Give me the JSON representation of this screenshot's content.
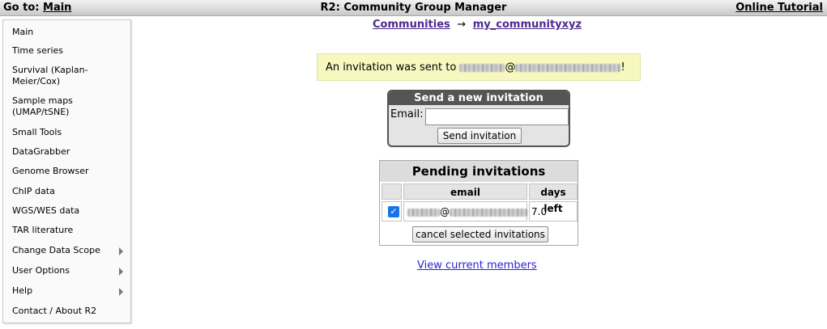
{
  "topbar": {
    "goto_prefix": "Go to:",
    "goto_link": "Main",
    "title": "R2: Community Group Manager",
    "tutorial": "Online Tutorial"
  },
  "sidebar": {
    "items": [
      {
        "label": "Main",
        "submenu": false
      },
      {
        "label": "Time series",
        "submenu": false
      },
      {
        "label": "Survival (Kaplan-Meier/Cox)",
        "submenu": false
      },
      {
        "label": "Sample maps (UMAP/tSNE)",
        "submenu": false
      },
      {
        "label": "Small Tools",
        "submenu": false
      },
      {
        "label": "DataGrabber",
        "submenu": false
      },
      {
        "label": "Genome Browser",
        "submenu": false
      },
      {
        "label": "ChIP data",
        "submenu": false
      },
      {
        "label": "WGS/WES data",
        "submenu": false
      },
      {
        "label": "TAR literature",
        "submenu": false
      },
      {
        "label": "Change Data Scope",
        "submenu": true
      },
      {
        "label": "User Options",
        "submenu": true
      },
      {
        "label": "Help",
        "submenu": true
      },
      {
        "label": "Contact / About R2",
        "submenu": false
      }
    ]
  },
  "breadcrumb": {
    "root": "Communities",
    "separator": "→",
    "current": "my_communityxyz"
  },
  "notice": {
    "prefix": "An invitation was sent to ",
    "at": "@",
    "suffix": "!"
  },
  "invite": {
    "title": "Send a new invitation",
    "email_label": "Email:",
    "email_value": "",
    "button": "Send invitation"
  },
  "pending": {
    "title": "Pending invitations",
    "columns": [
      "email",
      "days left"
    ],
    "rows": [
      {
        "checked": true,
        "at": "@",
        "days_left": "7.0"
      }
    ],
    "cancel_button": "cancel selected invitations"
  },
  "members_link": "View current members",
  "colors": {
    "notice_bg": "#f7f7c0",
    "breadcrumb_link": "#4b2a8c",
    "link": "#2a1fd6",
    "checkbox": "#1a73e8",
    "invite_header": "#555555"
  }
}
